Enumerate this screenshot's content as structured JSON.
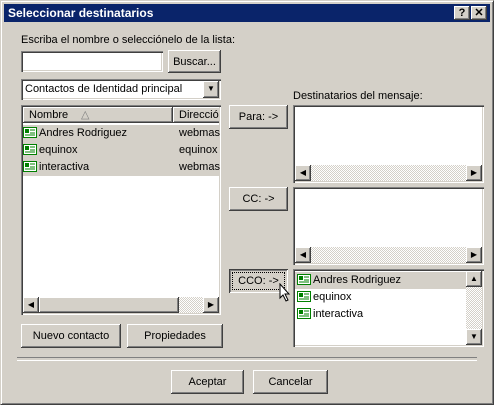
{
  "window": {
    "title": "Seleccionar destinatarios",
    "help_label": "?",
    "close_label": "✕"
  },
  "search": {
    "prompt": "Escriba el nombre o selecciónelo de la lista:",
    "value": "",
    "button": "Buscar..."
  },
  "source": {
    "selected": "Contactos de Identidad principal"
  },
  "contacts": {
    "columns": [
      "Nombre",
      "Direcció"
    ],
    "rows": [
      {
        "name": "Andres Rodriguez",
        "email": "webmas"
      },
      {
        "name": "equinox",
        "email": "equinox"
      },
      {
        "name": "interactiva",
        "email": "webmas"
      }
    ]
  },
  "buttons": {
    "para": "Para: ->",
    "cc": "CC: ->",
    "cco": "CCO: ->",
    "new_contact": "Nuevo contacto",
    "properties": "Propiedades",
    "accept": "Aceptar",
    "cancel": "Cancelar"
  },
  "recipients": {
    "label": "Destinatarios del mensaje:",
    "bcc": [
      "Andres Rodriguez",
      "equinox",
      "interactiva"
    ]
  },
  "icons": {
    "contact": "contact-card-icon",
    "sort": "sort-ascending-icon",
    "dropdown": "dropdown-arrow-icon",
    "cursor": "mouse-pointer-icon"
  }
}
